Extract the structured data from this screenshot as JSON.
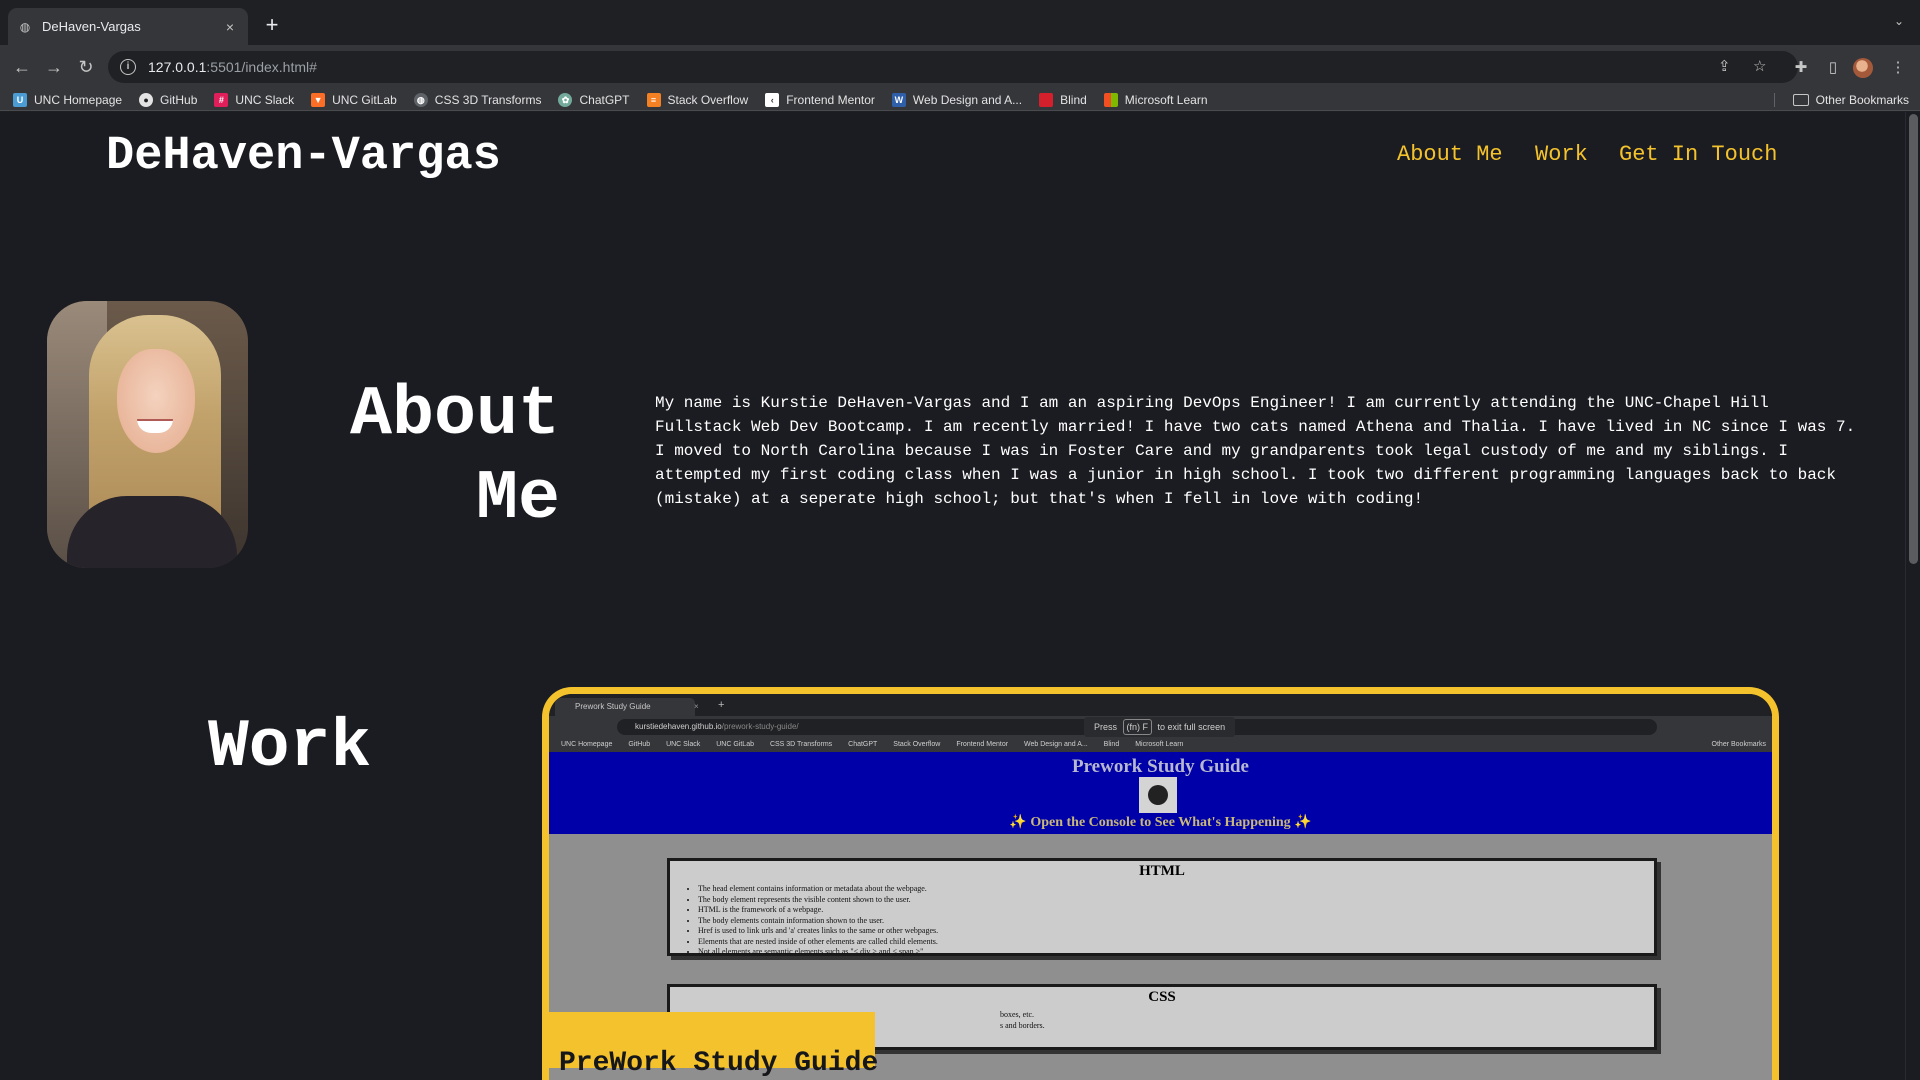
{
  "browser": {
    "tab_title": "DeHaven-Vargas",
    "tab_close": "×",
    "new_tab": "+",
    "url_host": "127.0.0.1",
    "url_rest": ":5501/index.html#",
    "bookmarks": [
      {
        "label": "UNC Homepage",
        "icon": "unc-icon",
        "color": "#4b9cd3"
      },
      {
        "label": "GitHub",
        "icon": "github-icon",
        "color": "#e3e3e3"
      },
      {
        "label": "UNC Slack",
        "icon": "slack-icon",
        "color": "#e01e5a"
      },
      {
        "label": "UNC GitLab",
        "icon": "gitlab-icon",
        "color": "#fc6d26"
      },
      {
        "label": "CSS 3D Transforms",
        "icon": "globe-icon",
        "color": "#9aa0a6"
      },
      {
        "label": "ChatGPT",
        "icon": "chatgpt-icon",
        "color": "#74aa9c"
      },
      {
        "label": "Stack Overflow",
        "icon": "stackoverflow-icon",
        "color": "#f48024"
      },
      {
        "label": "Frontend Mentor",
        "icon": "frontendmentor-icon",
        "color": "#ffffff"
      },
      {
        "label": "Web Design and A...",
        "icon": "w3-icon",
        "color": "#2e5fa8"
      },
      {
        "label": "Blind",
        "icon": "blind-icon",
        "color": "#d4202c"
      },
      {
        "label": "Microsoft Learn",
        "icon": "microsoft-icon",
        "color": "#f25022"
      }
    ],
    "other_bookmarks": "Other Bookmarks"
  },
  "site": {
    "title": "DeHaven-Vargas",
    "nav": [
      "About Me",
      "Work",
      "Get In Touch"
    ],
    "accent_color": "#f4c22c",
    "background": "#1b1c21"
  },
  "about": {
    "heading_line1": "About",
    "heading_line2": "Me",
    "text": "My name is Kurstie DeHaven-Vargas and I am an aspiring DevOps Engineer! I am currently attending the UNC-Chapel Hill Fullstack Web Dev Bootcamp. I am recently married! I have two cats named Athena and Thalia. I have lived in NC since I was 7. I moved to North Carolina because I was in Foster Care and my grandparents took legal custody of me and my siblings. I attempted my first coding class when I was a junior in high school. I took two different programming languages back to back (mistake) at a seperate high school; but that's when I fell in love with coding!"
  },
  "work": {
    "heading": "Work",
    "caption": "PreWork Study Guide",
    "preview": {
      "tab_title": "Prework Study Guide",
      "url_host": "kurstiedehaven.github.io",
      "url_rest": "/prework-study-guide/",
      "fullscreen_prefix": "Press",
      "fullscreen_key": "(fn) F",
      "fullscreen_suffix": "to exit full screen",
      "bookmarks": [
        "UNC Homepage",
        "GitHub",
        "UNC Slack",
        "UNC GitLab",
        "CSS 3D Transforms",
        "ChatGPT",
        "Stack Overflow",
        "Frontend Mentor",
        "Web Design and A...",
        "Blind",
        "Microsoft Learn"
      ],
      "other_bookmarks": "Other Bookmarks",
      "page_title": "Prework Study Guide",
      "page_subtitle": "✨ Open the Console to See What's Happening ✨",
      "html_heading": "HTML",
      "html_items": [
        "The head element contains information or metadata about the webpage.",
        "The body element represents the visible content shown to the user.",
        "HTML is the framework of a webpage.",
        "The body elements contain information shown to the user.",
        "Href is used to link urls and 'a' creates links to the same or other webpages.",
        "Elements that are nested inside of other elements are called child elements.",
        "Not all elements are semantic elements such as \"< div > and < span >\""
      ],
      "css_heading": "CSS",
      "css_items": [
        "boxes, etc.",
        "s and borders."
      ]
    }
  }
}
